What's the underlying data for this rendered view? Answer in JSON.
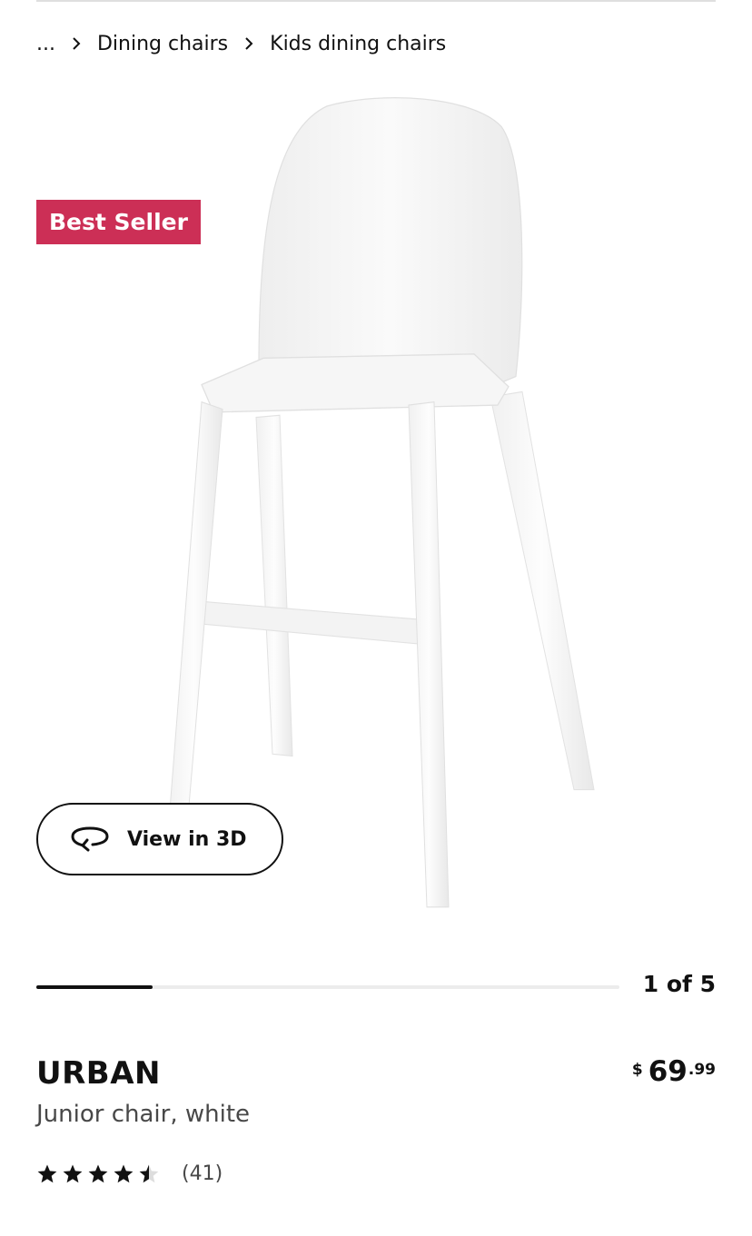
{
  "breadcrumb": {
    "items": [
      "...",
      "Dining chairs",
      "Kids dining chairs"
    ]
  },
  "gallery": {
    "badge": "Best Seller",
    "view_3d_label": "View in 3D",
    "counter": "1 of 5",
    "current_index": 1,
    "total_images": 5
  },
  "product": {
    "name": "URBAN",
    "description": "Junior chair, white",
    "price": {
      "currency": "$",
      "integer": "69",
      "decimal": ".99"
    },
    "rating": {
      "value": 4.5,
      "max": 5,
      "count_label": "(41)"
    }
  },
  "colors": {
    "badge": "#cc2f56",
    "text": "#111111",
    "muted": "#484848",
    "star": "#111111",
    "track": "#ececec"
  },
  "icons": {
    "breadcrumb_separator": "chevron-right-icon",
    "view_3d": "rotate-3d-icon",
    "rating": "star-icon"
  }
}
